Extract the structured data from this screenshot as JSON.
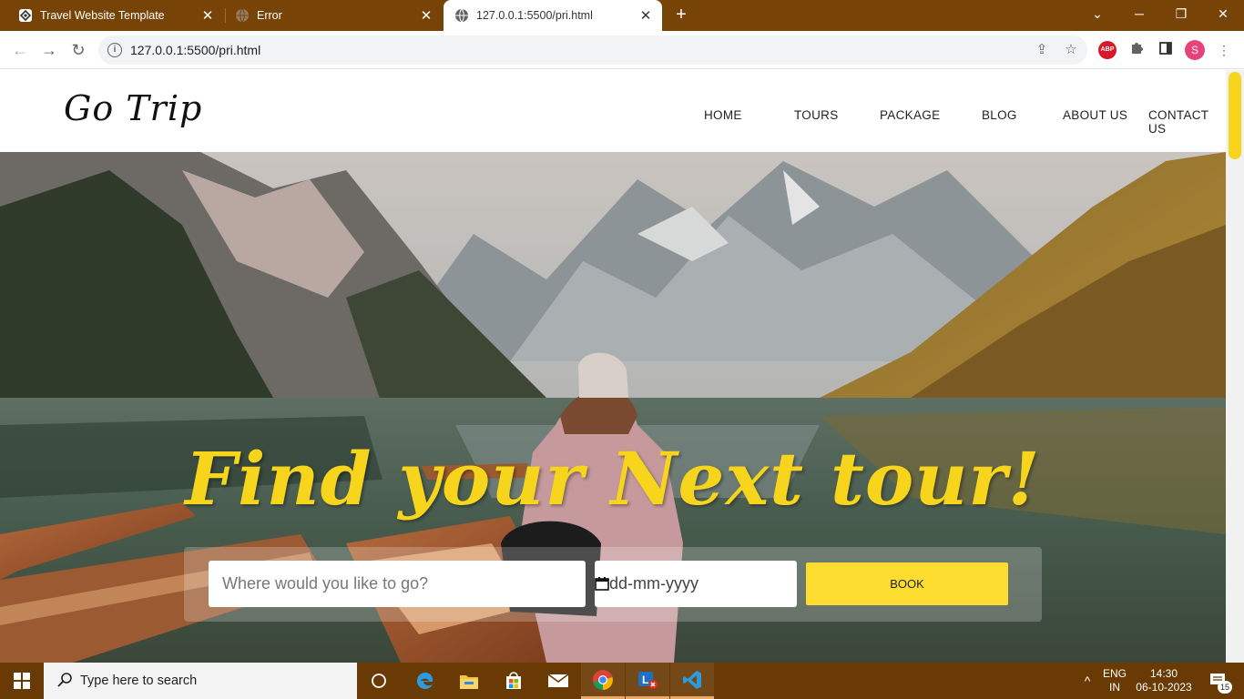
{
  "browser": {
    "tabs": [
      {
        "title": "Travel Website Template",
        "active": false
      },
      {
        "title": "Error",
        "active": false
      },
      {
        "title": "127.0.0.1:5500/pri.html",
        "active": true
      }
    ],
    "address": "127.0.0.1:5500/pri.html",
    "profile_initial": "S",
    "abp_label": "ABP"
  },
  "site": {
    "logo": "Go Trip",
    "nav": [
      "HOME",
      "TOURS",
      "PACKAGE",
      "BLOG",
      "ABOUT US",
      "CONTACT US"
    ],
    "headline": "Find your Next tour!",
    "search": {
      "destination_placeholder": "Where would you like to go?",
      "date_value": "dd-mm-yyyy",
      "book_label": "BOOK"
    },
    "accent_color": "#f7d51d"
  },
  "taskbar": {
    "search_text": "Type here to search",
    "lang_top": "ENG",
    "lang_bottom": "IN",
    "time": "14:30",
    "date": "06-10-2023",
    "notifications": "15"
  }
}
